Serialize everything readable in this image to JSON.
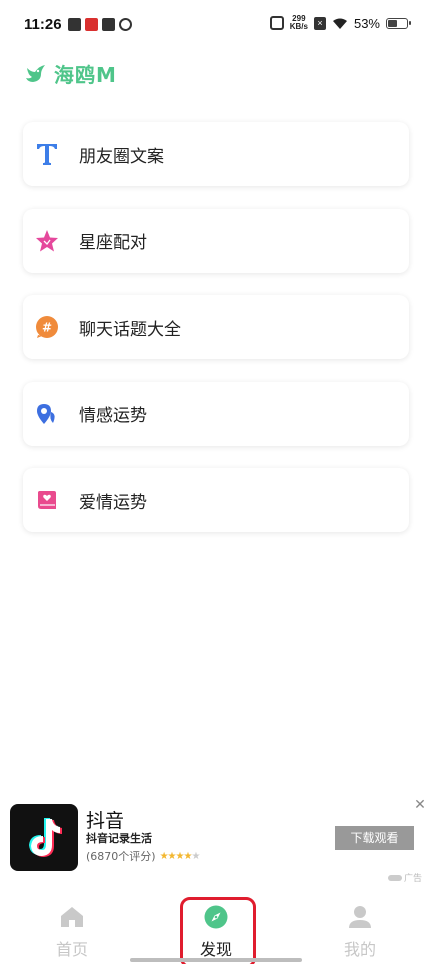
{
  "status_bar": {
    "time": "11:26",
    "net_speed_value": "299",
    "net_speed_unit": "KB/s",
    "battery_text": "53%",
    "battery_level": 0.53
  },
  "app": {
    "logo_text": "海鸥M",
    "accent_color": "#4fc58a"
  },
  "menu": {
    "items": [
      {
        "label": "朋友圈文案",
        "icon": "text-t-icon"
      },
      {
        "label": "星座配对",
        "icon": "star-icon"
      },
      {
        "label": "聊天话题大全",
        "icon": "hashtag-bubble-icon"
      },
      {
        "label": "情感运势",
        "icon": "location-pin-icon"
      },
      {
        "label": "爱情运势",
        "icon": "heart-book-icon"
      }
    ]
  },
  "ad": {
    "title": "抖音",
    "subtitle": "抖音记录生活",
    "rating_count": "(6870个评分)",
    "stars": 4,
    "button_label": "下载观看",
    "ad_mark": "广告"
  },
  "nav": {
    "home_label": "首页",
    "discover_label": "发现",
    "mine_label": "我的",
    "active": "discover"
  }
}
